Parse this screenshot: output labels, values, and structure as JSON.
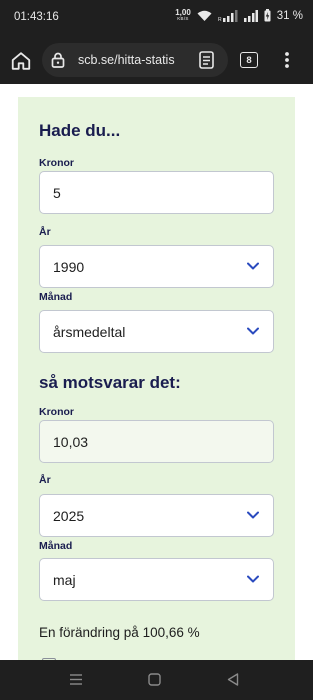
{
  "status_bar": {
    "time": "01:43:16",
    "net_speed": "1,00",
    "net_unit": "KB/S",
    "battery": "31 %"
  },
  "browser": {
    "url": "scb.se/hitta-statis",
    "tab_count": "8"
  },
  "form": {
    "section1_title": "Hade du...",
    "kronor_label": "Kronor",
    "kronor_value": "5",
    "year_label": "År",
    "year_value": "1990",
    "month_label": "Månad",
    "month_value": "årsmedeltal",
    "section2_title": "så motsvarar det:",
    "result_kronor_label": "Kronor",
    "result_kronor_value": "10,03",
    "result_year_label": "År",
    "result_year_value": "2025",
    "result_month_label": "Månad",
    "result_month_value": "maj",
    "change_text": "En förändring på 100,66 %"
  },
  "colors": {
    "card_bg": "#e7f4dd",
    "heading": "#1a1d4f",
    "chevron": "#2b4bbf",
    "system_bar": "#1f1f1f"
  }
}
